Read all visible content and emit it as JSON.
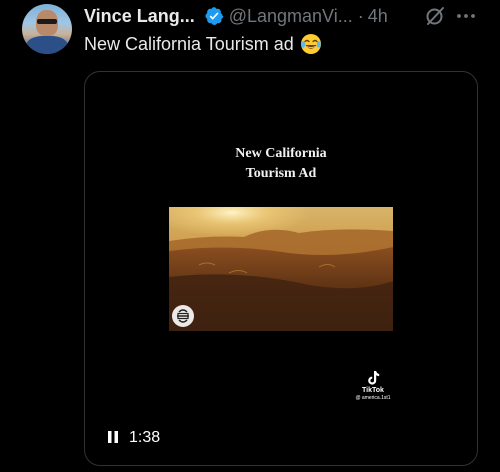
{
  "tweet": {
    "author_name": "Vince Lang...",
    "handle": "@LangmanVi...",
    "separator": "·",
    "time": "4h",
    "text": "New California Tourism ad",
    "emoji": "face-with-tears-of-joy",
    "icons": {
      "verified": "verified-badge-icon",
      "grok": "grok-icon",
      "more": "more-icon"
    },
    "colors": {
      "verified": "#1d9bf0",
      "secondary_text": "#71767b",
      "primary_text": "#e7e9ea",
      "border": "#2f3336"
    }
  },
  "media": {
    "video_title_line1": "New California",
    "video_title_line2": "Tourism Ad",
    "watermark_label": "TikTok",
    "watermark_user": "@ america.1st1",
    "duration": "1:38",
    "playback_state": "playing",
    "control_icon": "pause-icon"
  }
}
